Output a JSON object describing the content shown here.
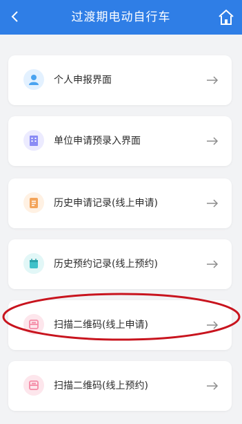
{
  "header": {
    "title": "过渡期电动自行车",
    "background": "#2f7ee6",
    "back_icon": "chevron-left-icon",
    "home_icon": "home-icon"
  },
  "menu": {
    "items": [
      {
        "label": "个人申报界面",
        "icon": "person-icon",
        "icon_color": "#4aa3f0"
      },
      {
        "label": "单位申请预录入界面",
        "icon": "building-icon",
        "icon_color": "#8b8cf5"
      },
      {
        "label": "历史申请记录(线上申请)",
        "icon": "document-icon",
        "icon_color": "#f3a45a"
      },
      {
        "label": "历史预约记录(线上预约)",
        "icon": "calendar-icon",
        "icon_color": "#3fc1c9"
      },
      {
        "label": "扫描二维码(线上申请)",
        "icon": "qr-scan-icon",
        "icon_color": "#f48aa6"
      },
      {
        "label": "扫描二维码(线上预约)",
        "icon": "qr-scan-icon",
        "icon_color": "#f48aa6"
      }
    ],
    "arrow_icon": "arrow-right-icon"
  },
  "annotation": {
    "highlight_color": "#c8141e",
    "highlighted_item": "扫描二维码(线上申请)"
  }
}
